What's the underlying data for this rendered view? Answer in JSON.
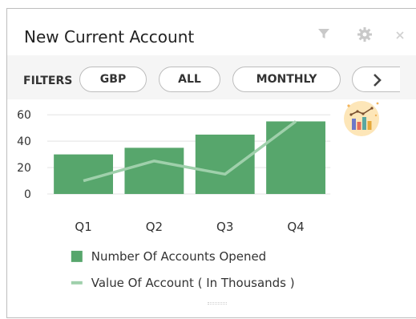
{
  "widget": {
    "title": "New Current Account",
    "icons": [
      "filter-icon",
      "gear-icon",
      "close-icon"
    ]
  },
  "filters": {
    "label": "FILTERS",
    "chips": [
      "GBP",
      "ALL",
      "MONTHLY",
      ""
    ],
    "next_icon": "chevron-right-icon"
  },
  "colors": {
    "bar": "#57a66c",
    "line": "#9fd0ab",
    "axis_text": "#333333",
    "grid": "#e3e3e3"
  },
  "chart_data": {
    "type": "bar",
    "categories": [
      "Q1",
      "Q2",
      "Q3",
      "Q4"
    ],
    "ylim": [
      0,
      60
    ],
    "yticks": [
      0,
      20,
      40,
      60
    ],
    "grid": true,
    "legend_placement": "bottom",
    "series": [
      {
        "name": "Number Of Accounts Opened",
        "kind": "bar",
        "values": [
          30,
          35,
          45,
          55
        ]
      },
      {
        "name": "Value Of Account ( In Thousands )",
        "kind": "line",
        "values": [
          10,
          25,
          15,
          55
        ]
      }
    ]
  }
}
